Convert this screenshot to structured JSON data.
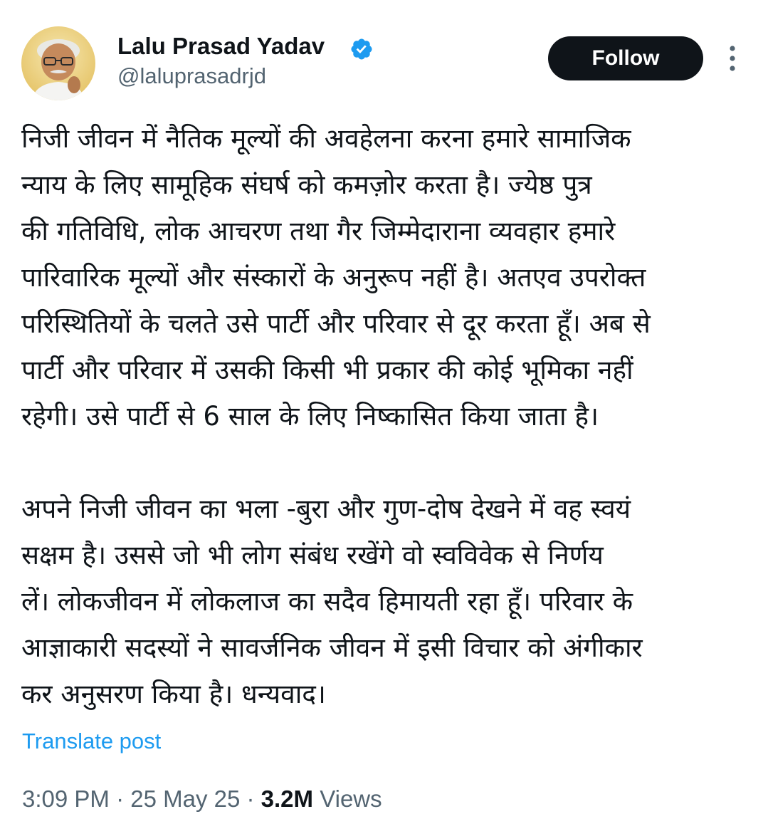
{
  "colors": {
    "text": "#0f1419",
    "secondary": "#536471",
    "link": "#1d9bf0",
    "verified": "#1d9bf0",
    "follow_bg": "#0f1419",
    "follow_text": "#ffffff"
  },
  "author": {
    "name": "Lalu Prasad Yadav",
    "handle": "@laluprasadrjd",
    "verified_icon": "verified-badge-icon"
  },
  "actions": {
    "follow_label": "Follow",
    "more_icon": "more-vertical-icon"
  },
  "post": {
    "lines": [
      "निजी जीवन में नैतिक मूल्यों की अवहेलना करना हमारे सामाजिक",
      "न्याय के लिए सामूहिक संघर्ष को कमज़ोर करता है। ज्येष्ठ पुत्र",
      "की गतिविधि, लोक आचरण तथा गैर जिम्मेदाराना व्यवहार हमारे",
      "पारिवारिक मूल्यों और संस्कारों के अनुरूप नहीं है। अतएव उपरोक्त",
      "परिस्थितियों के चलते उसे पार्टी और परिवार से दूर करता हूँ। अब से",
      "पार्टी और परिवार में उसकी किसी भी प्रकार की कोई भूमिका नहीं",
      "रहेगी। उसे पार्टी से 6 साल के लिए निष्कासित किया जाता है।",
      "",
      "अपने निजी जीवन का भला -बुरा और गुण-दोष देखने में वह स्वयं",
      "सक्षम है। उससे जो भी लोग संबंध रखेंगे वो स्वविवेक से निर्णय",
      "लें। लोकजीवन में लोकलाज का सदैव हिमायती रहा हूँ। परिवार के",
      "आज्ञाकारी सदस्यों ने सावर्जनिक जीवन में इसी विचार को अंगीकार",
      "कर अनुसरण किया है। धन्यवाद।"
    ],
    "translate_label": "Translate post"
  },
  "meta": {
    "time": "3:09 PM",
    "separator": " · ",
    "date": "25 May 25",
    "views_count": "3.2M",
    "views_label": " Views"
  }
}
